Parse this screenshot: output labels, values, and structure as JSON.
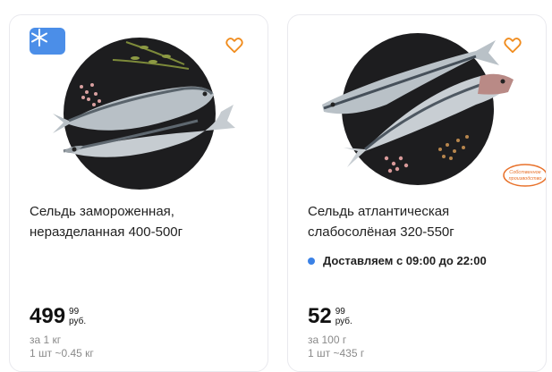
{
  "products": [
    {
      "title": "Сельдь замороженная, неразделанная 400-500г",
      "price_rub": "499",
      "price_kop": "99",
      "currency": "руб.",
      "unit": "за 1 кг",
      "piece_weight": "1 шт ~0.45 кг",
      "badge_icon": "snowflake-icon",
      "favorite_icon": "heart-icon"
    },
    {
      "title": "Сельдь атлантическая слабосолёная 320-550г",
      "delivery": "Доставляем с 09:00 до 22:00",
      "price_rub": "52",
      "price_kop": "99",
      "currency": "руб.",
      "unit": "за 100 г",
      "piece_weight": "1 шт ~435 г",
      "badge_text": "Собственное производство",
      "favorite_icon": "heart-icon"
    }
  ],
  "colors": {
    "accent_orange": "#f08c1e",
    "frozen_blue": "#4b8ee8",
    "delivery_dot": "#3b82e6",
    "muted_text": "#8a8a8a"
  }
}
